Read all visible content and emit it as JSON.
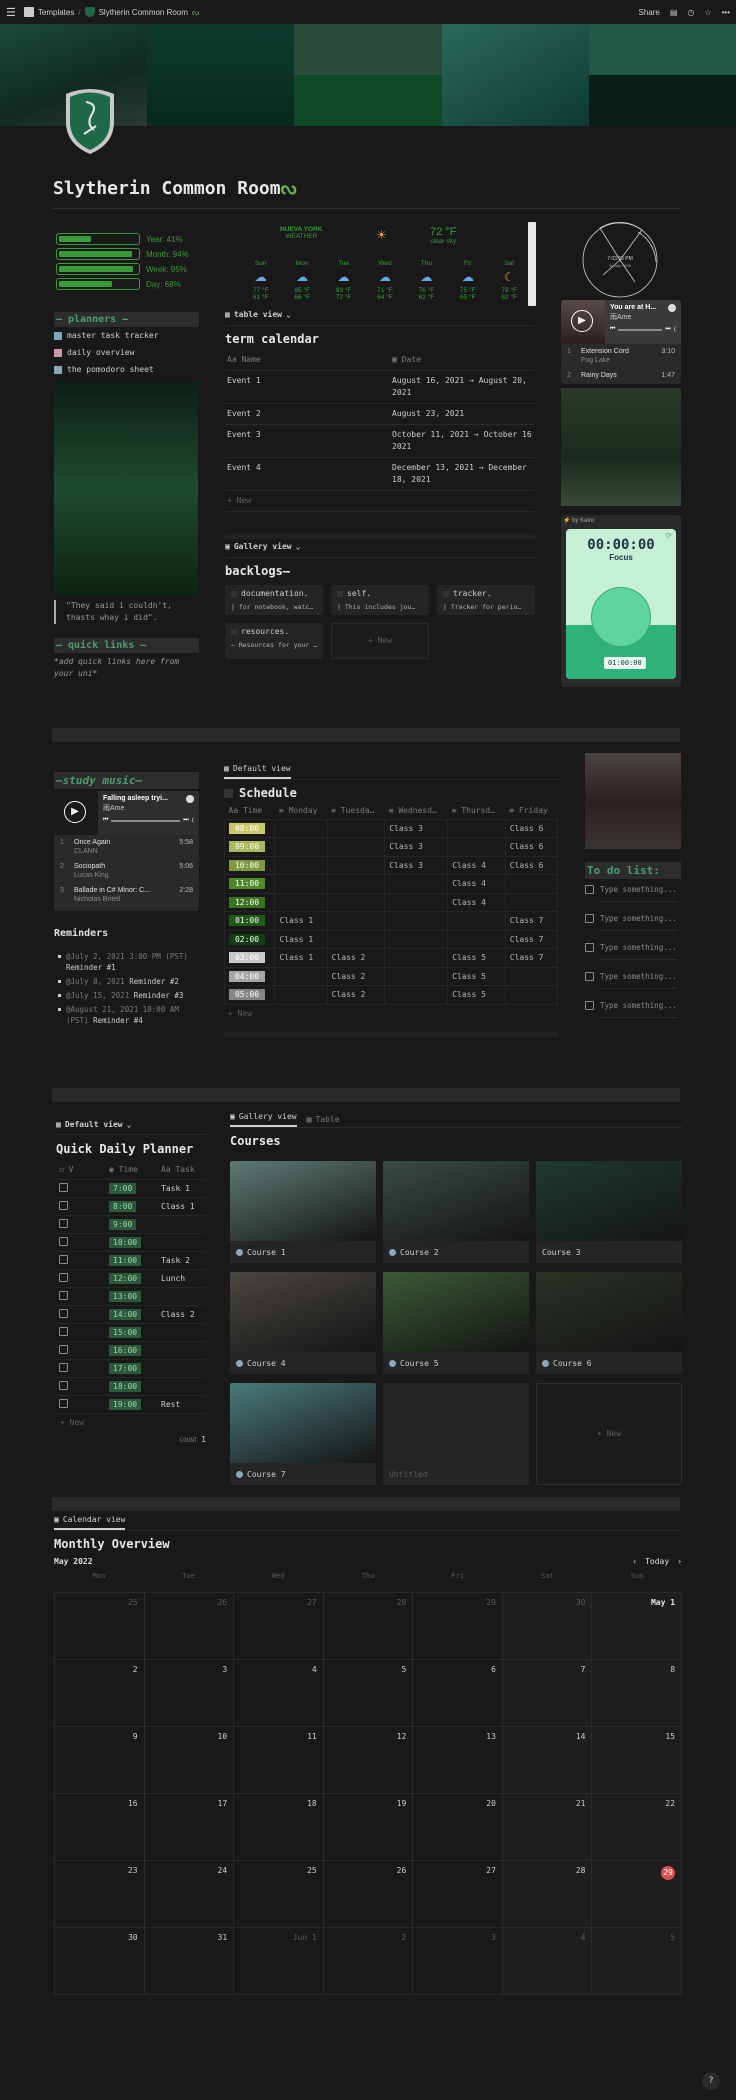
{
  "topbar": {
    "menu_icon": "hamburger-icon",
    "breadcrumb": [
      "Templates",
      "Slytherin Common Room"
    ],
    "share_label": "Share",
    "icons": [
      "comment-icon",
      "clock-icon",
      "star-icon",
      "more-icon"
    ]
  },
  "page": {
    "title": "Slytherin Common Room",
    "title_icon": "snake-icon",
    "page_icon": "slytherin-shield-icon"
  },
  "progress": [
    {
      "label": "Year: 41%",
      "value": 0.41
    },
    {
      "label": "Month: 94%",
      "value": 0.94
    },
    {
      "label": "Week: 95%",
      "value": 0.95
    },
    {
      "label": "Day: 68%",
      "value": 0.68
    }
  ],
  "weather": {
    "city": "NUEVA YORK",
    "subtitle": "WEATHER",
    "current_temp": "72 °F",
    "condition": "clear sky",
    "days": [
      {
        "day": "Sun",
        "icon": "sun-cloud-icon",
        "high": "77 °F",
        "low": "61 °F"
      },
      {
        "day": "Mon",
        "icon": "sun-cloud-icon",
        "high": "85 °F",
        "low": "66 °F"
      },
      {
        "day": "Tue",
        "icon": "rain-cloud-icon",
        "high": "93 °F",
        "low": "72 °F"
      },
      {
        "day": "Wed",
        "icon": "rain-cloud-icon",
        "high": "71 °F",
        "low": "64 °F"
      },
      {
        "day": "Thu",
        "icon": "cloud-icon",
        "high": "76 °F",
        "low": "62 °F"
      },
      {
        "day": "Fri",
        "icon": "sun-cloud-icon",
        "high": "75 °F",
        "low": "65 °F"
      },
      {
        "day": "Sat",
        "icon": "moon-icon",
        "high": "78 °F",
        "low": "62 °F"
      }
    ]
  },
  "planners": {
    "header": "— planners —",
    "links": [
      "master task tracker",
      "daily overview",
      "the pomodoro sheet"
    ]
  },
  "quote": "\"They said i couldn't, thasts whay i did\".",
  "quick_links": {
    "header": "— quick links —",
    "note": "*add quick links here from your uni*"
  },
  "term_calendar": {
    "view": "table view",
    "title": "term calendar",
    "columns": [
      "Name",
      "Date"
    ],
    "rows": [
      {
        "name": "Event 1",
        "date": "August 16, 2021 → August 20, 2021"
      },
      {
        "name": "Event 2",
        "date": "August 23, 2021"
      },
      {
        "name": "Event 3",
        "date": "October 11, 2021 → October 16 2021"
      },
      {
        "name": "Event 4",
        "date": "December 13, 2021 → December 18, 2021"
      }
    ],
    "new_label": "+ New"
  },
  "backlogs": {
    "view": "Gallery view",
    "title": "backlogs—",
    "cards": [
      {
        "title": "documentation.",
        "desc": "| for notebook, watc…"
      },
      {
        "title": "self.",
        "desc": "| This includes jou…"
      },
      {
        "title": "tracker.",
        "desc": "| Tracker for perio…"
      },
      {
        "title": "resources.",
        "desc": "— Resources for your …"
      }
    ],
    "new_label": "+ New"
  },
  "clock": {
    "time": "7:03:55 PM",
    "date": "Sunday • 8/29"
  },
  "player1": {
    "title": "You are at H...",
    "artist": "雨Ame",
    "tracks": [
      {
        "n": "1",
        "title": "Extension Cord",
        "artist": "Fog Lake",
        "dur": "3:10"
      },
      {
        "n": "2",
        "title": "Rainy Days",
        "artist": "",
        "dur": "1:47"
      }
    ]
  },
  "pomodoro": {
    "credit": "by Kairo",
    "time": "00:00:00",
    "mode": "Focus",
    "duration": "01:00:00"
  },
  "study_music": {
    "header": "—study music—",
    "title": "Falling asleep tryi...",
    "artist": "雨Ame",
    "tracks": [
      {
        "n": "1",
        "title": "Once Again",
        "artist": "CLANN",
        "dur": "5:58"
      },
      {
        "n": "2",
        "title": "Sociopath",
        "artist": "Lucas King",
        "dur": "5:06"
      },
      {
        "n": "3",
        "title": "Ballade in C# Minor: C...",
        "artist": "Nicholas Britell",
        "dur": "2:28"
      }
    ]
  },
  "reminders": {
    "title": "Reminders",
    "items": [
      {
        "date": "@July 2, 2021 3:00 PM (PST)",
        "text": "Reminder #1"
      },
      {
        "date": "@July 8, 2021",
        "text": "Reminder #2"
      },
      {
        "date": "@July 15, 2021",
        "text": "Reminder #3"
      },
      {
        "date": "@August 21, 2021 10:00 AM (PST)",
        "text": "Reminder #4"
      }
    ]
  },
  "schedule": {
    "view": "Default view",
    "title": "Schedule",
    "columns": [
      "Time",
      "Monday",
      "Tuesda…",
      "Wednesd…",
      "Thursd…",
      "Friday"
    ],
    "rows": [
      {
        "time": "08:00",
        "color": "#c9c96a",
        "cells": [
          "",
          "",
          "Class 3",
          "",
          "Class 6"
        ]
      },
      {
        "time": "09:00",
        "color": "#a8b85a",
        "cells": [
          "",
          "",
          "Class 3",
          "",
          "Class 6"
        ]
      },
      {
        "time": "10:00",
        "color": "#7e9a3c",
        "cells": [
          "",
          "",
          "Class 3",
          "Class 4",
          "Class 6"
        ]
      },
      {
        "time": "11:00",
        "color": "#4f8a2a",
        "cells": [
          "",
          "",
          "",
          "Class 4",
          ""
        ]
      },
      {
        "time": "12:00",
        "color": "#3a7420",
        "cells": [
          "",
          "",
          "",
          "Class 4",
          ""
        ]
      },
      {
        "time": "01:00",
        "color": "#1f5a18",
        "cells": [
          "Class 1",
          "",
          "",
          "",
          "Class 7"
        ]
      },
      {
        "time": "02:00",
        "color": "#123d10",
        "cells": [
          "Class 1",
          "",
          "",
          "",
          "Class 7"
        ]
      },
      {
        "time": "03:00",
        "color": "#c8c8c8",
        "cells": [
          "Class 1",
          "Class 2",
          "",
          "Class 5",
          "Class 7"
        ]
      },
      {
        "time": "04:00",
        "color": "#a6a6a6",
        "cells": [
          "",
          "Class 2",
          "",
          "Class 5",
          ""
        ]
      },
      {
        "time": "05:00",
        "color": "#858585",
        "cells": [
          "",
          "Class 2",
          "",
          "Class 5",
          ""
        ]
      }
    ],
    "new_label": "+ New"
  },
  "todo": {
    "title": "To do list:",
    "items": [
      "Type something...",
      "Type something...",
      "Type something...",
      "Type something...",
      "Type something..."
    ]
  },
  "daily_planner": {
    "view": "Default view",
    "title": "Quick Daily Planner",
    "columns": [
      "V",
      "Time",
      "Task"
    ],
    "rows": [
      {
        "time": "7:00",
        "task": "Task 1"
      },
      {
        "time": "8:00",
        "task": "Class 1"
      },
      {
        "time": "9:00",
        "task": ""
      },
      {
        "time": "10:00",
        "task": ""
      },
      {
        "time": "11:00",
        "task": "Task 2"
      },
      {
        "time": "12:00",
        "task": "Lunch"
      },
      {
        "time": "13:00",
        "task": ""
      },
      {
        "time": "14:00",
        "task": "Class 2"
      },
      {
        "time": "15:00",
        "task": ""
      },
      {
        "time": "16:00",
        "task": ""
      },
      {
        "time": "17:00",
        "task": ""
      },
      {
        "time": "18:00",
        "task": ""
      },
      {
        "time": "19:00",
        "task": "Rest"
      }
    ],
    "new_label": "+ New",
    "count_label": "COUNT",
    "count_value": "1"
  },
  "courses": {
    "tabs": [
      "Gallery view",
      "Table"
    ],
    "title": "Courses",
    "cards": [
      {
        "name": "Course 1",
        "img": "#5d7a74"
      },
      {
        "name": "Course 2",
        "img": "#3a4a44"
      },
      {
        "name": "Course 3",
        "img": "#1e3a30"
      },
      {
        "name": "Course 4",
        "img": "#4a4640"
      },
      {
        "name": "Course 5",
        "img": "#3a5a34"
      },
      {
        "name": "Course 6",
        "img": "#2a3226"
      },
      {
        "name": "Course 7",
        "img": "#4a7a7a"
      },
      {
        "name": "Untitled",
        "img": ""
      }
    ],
    "new_label": "+ New"
  },
  "calendar": {
    "view": "Calendar view",
    "title": "Monthly Overview",
    "month": "May 2022",
    "today_label": "Today",
    "weekdays": [
      "Mon",
      "Tue",
      "Wed",
      "Thu",
      "Fri",
      "Sat",
      "Sun"
    ],
    "weeks": [
      [
        "25",
        "26",
        "27",
        "28",
        "29",
        "30",
        "May 1"
      ],
      [
        "2",
        "3",
        "4",
        "5",
        "6",
        "7",
        "8"
      ],
      [
        "9",
        "10",
        "11",
        "12",
        "13",
        "14",
        "15"
      ],
      [
        "16",
        "17",
        "18",
        "19",
        "20",
        "21",
        "22"
      ],
      [
        "23",
        "24",
        "25",
        "26",
        "27",
        "28",
        "29"
      ],
      [
        "30",
        "31",
        "Jun 1",
        "2",
        "3",
        "4",
        "5"
      ]
    ],
    "today": "29"
  },
  "help_label": "?"
}
